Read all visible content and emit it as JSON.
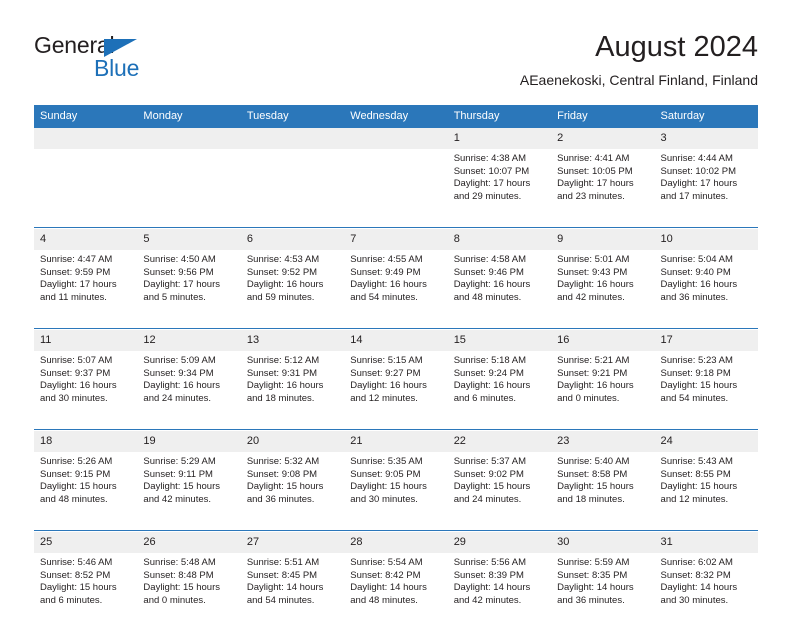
{
  "brand": {
    "name_top": "General",
    "name_bottom": "Blue",
    "accent_color": "#1d70b8"
  },
  "header": {
    "title": "August 2024",
    "subtitle": "AEaenekoski, Central Finland, Finland"
  },
  "theme": {
    "header_blue": "#2b77ba",
    "daynum_band": "#efefef",
    "text": "#231f20"
  },
  "calendar": {
    "weekday_headers": [
      "Sunday",
      "Monday",
      "Tuesday",
      "Wednesday",
      "Thursday",
      "Friday",
      "Saturday"
    ],
    "weeks": [
      [
        {
          "day": "",
          "lines": [
            "",
            "",
            "",
            ""
          ]
        },
        {
          "day": "",
          "lines": [
            "",
            "",
            "",
            ""
          ]
        },
        {
          "day": "",
          "lines": [
            "",
            "",
            "",
            ""
          ]
        },
        {
          "day": "",
          "lines": [
            "",
            "",
            "",
            ""
          ]
        },
        {
          "day": "1",
          "lines": [
            "Sunrise: 4:38 AM",
            "Sunset: 10:07 PM",
            "Daylight: 17 hours",
            "and 29 minutes."
          ]
        },
        {
          "day": "2",
          "lines": [
            "Sunrise: 4:41 AM",
            "Sunset: 10:05 PM",
            "Daylight: 17 hours",
            "and 23 minutes."
          ]
        },
        {
          "day": "3",
          "lines": [
            "Sunrise: 4:44 AM",
            "Sunset: 10:02 PM",
            "Daylight: 17 hours",
            "and 17 minutes."
          ]
        }
      ],
      [
        {
          "day": "4",
          "lines": [
            "Sunrise: 4:47 AM",
            "Sunset: 9:59 PM",
            "Daylight: 17 hours",
            "and 11 minutes."
          ]
        },
        {
          "day": "5",
          "lines": [
            "Sunrise: 4:50 AM",
            "Sunset: 9:56 PM",
            "Daylight: 17 hours",
            "and 5 minutes."
          ]
        },
        {
          "day": "6",
          "lines": [
            "Sunrise: 4:53 AM",
            "Sunset: 9:52 PM",
            "Daylight: 16 hours",
            "and 59 minutes."
          ]
        },
        {
          "day": "7",
          "lines": [
            "Sunrise: 4:55 AM",
            "Sunset: 9:49 PM",
            "Daylight: 16 hours",
            "and 54 minutes."
          ]
        },
        {
          "day": "8",
          "lines": [
            "Sunrise: 4:58 AM",
            "Sunset: 9:46 PM",
            "Daylight: 16 hours",
            "and 48 minutes."
          ]
        },
        {
          "day": "9",
          "lines": [
            "Sunrise: 5:01 AM",
            "Sunset: 9:43 PM",
            "Daylight: 16 hours",
            "and 42 minutes."
          ]
        },
        {
          "day": "10",
          "lines": [
            "Sunrise: 5:04 AM",
            "Sunset: 9:40 PM",
            "Daylight: 16 hours",
            "and 36 minutes."
          ]
        }
      ],
      [
        {
          "day": "11",
          "lines": [
            "Sunrise: 5:07 AM",
            "Sunset: 9:37 PM",
            "Daylight: 16 hours",
            "and 30 minutes."
          ]
        },
        {
          "day": "12",
          "lines": [
            "Sunrise: 5:09 AM",
            "Sunset: 9:34 PM",
            "Daylight: 16 hours",
            "and 24 minutes."
          ]
        },
        {
          "day": "13",
          "lines": [
            "Sunrise: 5:12 AM",
            "Sunset: 9:31 PM",
            "Daylight: 16 hours",
            "and 18 minutes."
          ]
        },
        {
          "day": "14",
          "lines": [
            "Sunrise: 5:15 AM",
            "Sunset: 9:27 PM",
            "Daylight: 16 hours",
            "and 12 minutes."
          ]
        },
        {
          "day": "15",
          "lines": [
            "Sunrise: 5:18 AM",
            "Sunset: 9:24 PM",
            "Daylight: 16 hours",
            "and 6 minutes."
          ]
        },
        {
          "day": "16",
          "lines": [
            "Sunrise: 5:21 AM",
            "Sunset: 9:21 PM",
            "Daylight: 16 hours",
            "and 0 minutes."
          ]
        },
        {
          "day": "17",
          "lines": [
            "Sunrise: 5:23 AM",
            "Sunset: 9:18 PM",
            "Daylight: 15 hours",
            "and 54 minutes."
          ]
        }
      ],
      [
        {
          "day": "18",
          "lines": [
            "Sunrise: 5:26 AM",
            "Sunset: 9:15 PM",
            "Daylight: 15 hours",
            "and 48 minutes."
          ]
        },
        {
          "day": "19",
          "lines": [
            "Sunrise: 5:29 AM",
            "Sunset: 9:11 PM",
            "Daylight: 15 hours",
            "and 42 minutes."
          ]
        },
        {
          "day": "20",
          "lines": [
            "Sunrise: 5:32 AM",
            "Sunset: 9:08 PM",
            "Daylight: 15 hours",
            "and 36 minutes."
          ]
        },
        {
          "day": "21",
          "lines": [
            "Sunrise: 5:35 AM",
            "Sunset: 9:05 PM",
            "Daylight: 15 hours",
            "and 30 minutes."
          ]
        },
        {
          "day": "22",
          "lines": [
            "Sunrise: 5:37 AM",
            "Sunset: 9:02 PM",
            "Daylight: 15 hours",
            "and 24 minutes."
          ]
        },
        {
          "day": "23",
          "lines": [
            "Sunrise: 5:40 AM",
            "Sunset: 8:58 PM",
            "Daylight: 15 hours",
            "and 18 minutes."
          ]
        },
        {
          "day": "24",
          "lines": [
            "Sunrise: 5:43 AM",
            "Sunset: 8:55 PM",
            "Daylight: 15 hours",
            "and 12 minutes."
          ]
        }
      ],
      [
        {
          "day": "25",
          "lines": [
            "Sunrise: 5:46 AM",
            "Sunset: 8:52 PM",
            "Daylight: 15 hours",
            "and 6 minutes."
          ]
        },
        {
          "day": "26",
          "lines": [
            "Sunrise: 5:48 AM",
            "Sunset: 8:48 PM",
            "Daylight: 15 hours",
            "and 0 minutes."
          ]
        },
        {
          "day": "27",
          "lines": [
            "Sunrise: 5:51 AM",
            "Sunset: 8:45 PM",
            "Daylight: 14 hours",
            "and 54 minutes."
          ]
        },
        {
          "day": "28",
          "lines": [
            "Sunrise: 5:54 AM",
            "Sunset: 8:42 PM",
            "Daylight: 14 hours",
            "and 48 minutes."
          ]
        },
        {
          "day": "29",
          "lines": [
            "Sunrise: 5:56 AM",
            "Sunset: 8:39 PM",
            "Daylight: 14 hours",
            "and 42 minutes."
          ]
        },
        {
          "day": "30",
          "lines": [
            "Sunrise: 5:59 AM",
            "Sunset: 8:35 PM",
            "Daylight: 14 hours",
            "and 36 minutes."
          ]
        },
        {
          "day": "31",
          "lines": [
            "Sunrise: 6:02 AM",
            "Sunset: 8:32 PM",
            "Daylight: 14 hours",
            "and 30 minutes."
          ]
        }
      ]
    ]
  }
}
